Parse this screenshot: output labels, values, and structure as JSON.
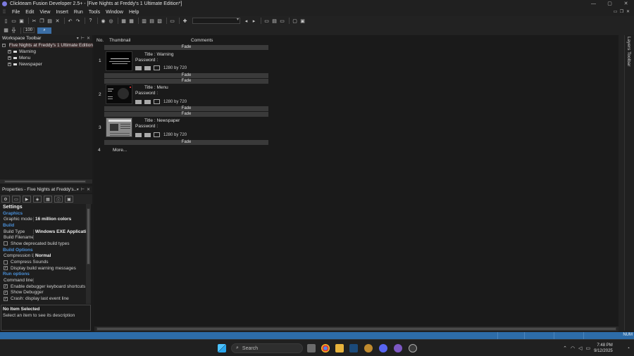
{
  "window": {
    "title": "Clickteam Fusion Developer 2.5+ - [Five Nights at Freddy's 1 Ultimate Edition*]",
    "controls": [
      "—",
      "▢",
      "✕"
    ]
  },
  "menubar": {
    "items": [
      "File",
      "Edit",
      "View",
      "Insert",
      "Run",
      "Tools",
      "Window",
      "Help"
    ],
    "mdi_controls": [
      "▭",
      "❐",
      "✕"
    ]
  },
  "toolbar": {
    "zoom_value": "100"
  },
  "workspace": {
    "title": "Workspace Toolbar",
    "root": "Five Nights at Freddy's 1 Ultimate Edition",
    "frames": [
      "Warning",
      "Menu",
      "Newspaper"
    ]
  },
  "properties": {
    "title": "Properties - Five Nights at Freddy's...",
    "settings_label": "Settings",
    "rows": [
      {
        "type": "cat",
        "text": "Graphics"
      },
      {
        "type": "kv",
        "key": "Graphic mode",
        "value": "16 million colors"
      },
      {
        "type": "cat",
        "text": "Build"
      },
      {
        "type": "kv",
        "key": "Build Type",
        "value": "Windows EXE Applicati"
      },
      {
        "type": "kv",
        "key": "Build Filename",
        "value": ""
      },
      {
        "type": "chk",
        "checked": false,
        "text": "Show deprecated build types"
      },
      {
        "type": "cat",
        "text": "Build Options"
      },
      {
        "type": "kv",
        "key": "Compression Lev",
        "value": "Normal"
      },
      {
        "type": "chk",
        "checked": false,
        "text": "Compress Sounds"
      },
      {
        "type": "chk",
        "checked": true,
        "text": "Display build warning messages"
      },
      {
        "type": "cat",
        "text": "Run options"
      },
      {
        "type": "kv",
        "key": "Command line",
        "value": ""
      },
      {
        "type": "chk",
        "checked": true,
        "text": "Enable debugger keyboard shortcuts"
      },
      {
        "type": "chk",
        "checked": true,
        "text": "Show Debugger"
      },
      {
        "type": "chk",
        "checked": true,
        "text": "Crash: display last event line"
      }
    ],
    "description_title": "No Item Selected",
    "description_text": "Select an item to see its description"
  },
  "storyboard": {
    "headers": {
      "no": "No.",
      "thumbnail": "Thumbnail",
      "comments": "Comments"
    },
    "fade_label": "Fade",
    "title_prefix": "Title :",
    "password_label": "Password :",
    "size_label": "1280 by 720",
    "frames": [
      {
        "no": "1",
        "title": "Warning"
      },
      {
        "no": "2",
        "title": "Menu"
      },
      {
        "no": "3",
        "title": "Newspaper"
      }
    ],
    "more_no": "4",
    "more_label": "More..."
  },
  "layers_tab": "Layers Toolbar",
  "statusbar": {
    "num": "NUM"
  },
  "taskbar": {
    "search_placeholder": "Search",
    "time": "7:48 PM",
    "date": "9/12/2025",
    "app_icons": [
      "task-view-icon",
      "chrome-icon",
      "file-explorer-icon",
      "steam-icon",
      "clickteam-icon",
      "discord-icon",
      "obs-icon",
      "fusion-icon"
    ]
  },
  "colors": {
    "accent": "#2d6ca8",
    "category_text": "#4a90d9",
    "root_icon": "#e07a43"
  }
}
